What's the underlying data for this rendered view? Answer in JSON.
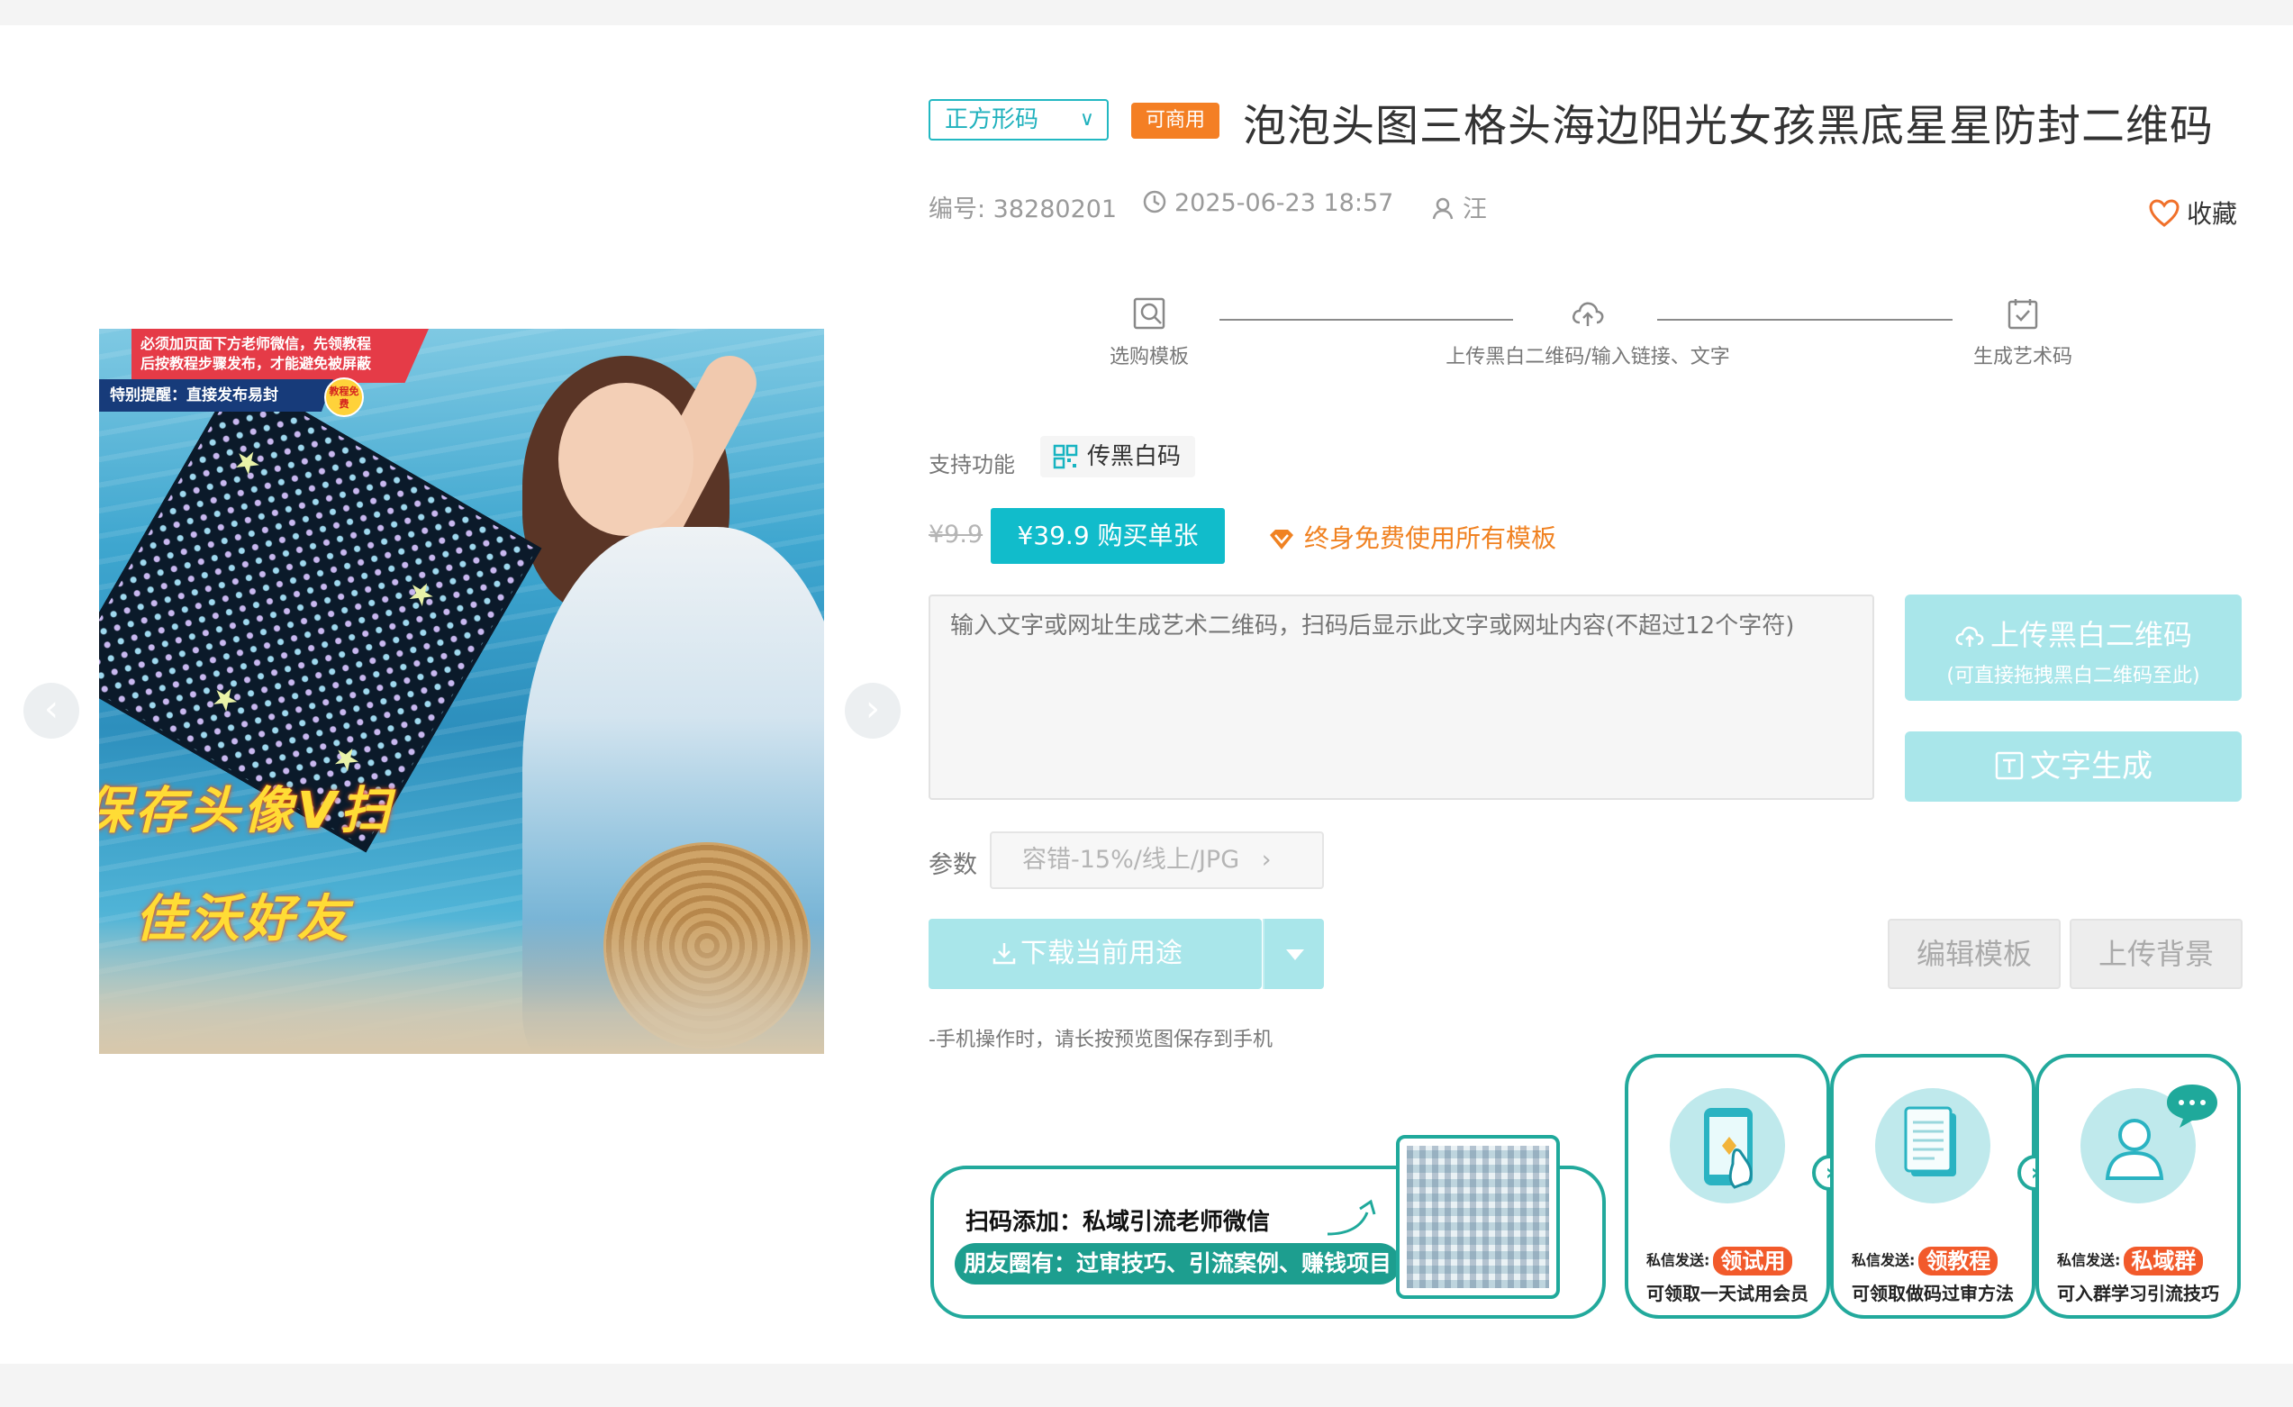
{
  "header": {
    "type_select": "正方形码",
    "commercial_badge": "可商用",
    "title": "泡泡头图三格头海边阳光女孩黑底星星防封二维码"
  },
  "meta": {
    "id_text": "编号: 38280201",
    "datetime": "2025-06-23 18:57",
    "author": "汪",
    "favorite_label": "收藏"
  },
  "steps": [
    {
      "label": "选购模板",
      "icon": "search-template-icon"
    },
    {
      "label": "上传黑白二维码/输入链接、文字",
      "icon": "cloud-upload-icon"
    },
    {
      "label": "生成艺术码",
      "icon": "calendar-check-icon"
    }
  ],
  "features": {
    "label": "支持功能",
    "chip": "传黑白码"
  },
  "pricing": {
    "old_price": "¥9.9",
    "buy_button": "¥39.9 购买单张",
    "vip_link": "终身免费使用所有模板"
  },
  "input": {
    "placeholder": "输入文字或网址生成艺术二维码，扫码后显示此文字或网址内容(不超过12个字符)"
  },
  "upload": {
    "main_label": "上传黑白二维码",
    "sub_label": "(可直接拖拽黑白二维码至此)"
  },
  "text_gen_label": "文字生成",
  "params": {
    "label": "参数",
    "value": "容错-15%/线上/JPG"
  },
  "actions": {
    "download_label": "下载当前用途",
    "edit_template": "编辑模板",
    "upload_background": "上传背景"
  },
  "hint": "-手机操作时，请长按预览图保存到手机",
  "preview": {
    "notice_line1": "必须加页面下方老师微信，先领教程",
    "notice_line2": "后按教程步骤发布，才能避免被屏蔽",
    "notice_highlight": "特别提醒：直接发布易封",
    "notice_badge": "教程免费",
    "overlay_line1": "保存头像V扫",
    "overlay_line2": "佳沃好友"
  },
  "promo": {
    "wechat_title": "扫码添加：私域引流老师微信",
    "wechat_pill": "朋友圈有：过审技巧、引流案例、赚钱项目",
    "cards": [
      {
        "prefix": "私信发送:",
        "tag": "领试用",
        "desc": "可领取一天试用会员",
        "icon": "phone-tap-icon"
      },
      {
        "prefix": "私信发送:",
        "tag": "领教程",
        "desc": "可领取做码过审方法",
        "icon": "document-icon"
      },
      {
        "prefix": "私信发送:",
        "tag": "私域群",
        "desc": "可入群学习引流技巧",
        "icon": "user-chat-icon"
      }
    ]
  },
  "colors": {
    "accent": "#11bccb",
    "accent_light": "#a9e6ea",
    "orange": "#f47f24",
    "promo_green": "#22a99c"
  }
}
